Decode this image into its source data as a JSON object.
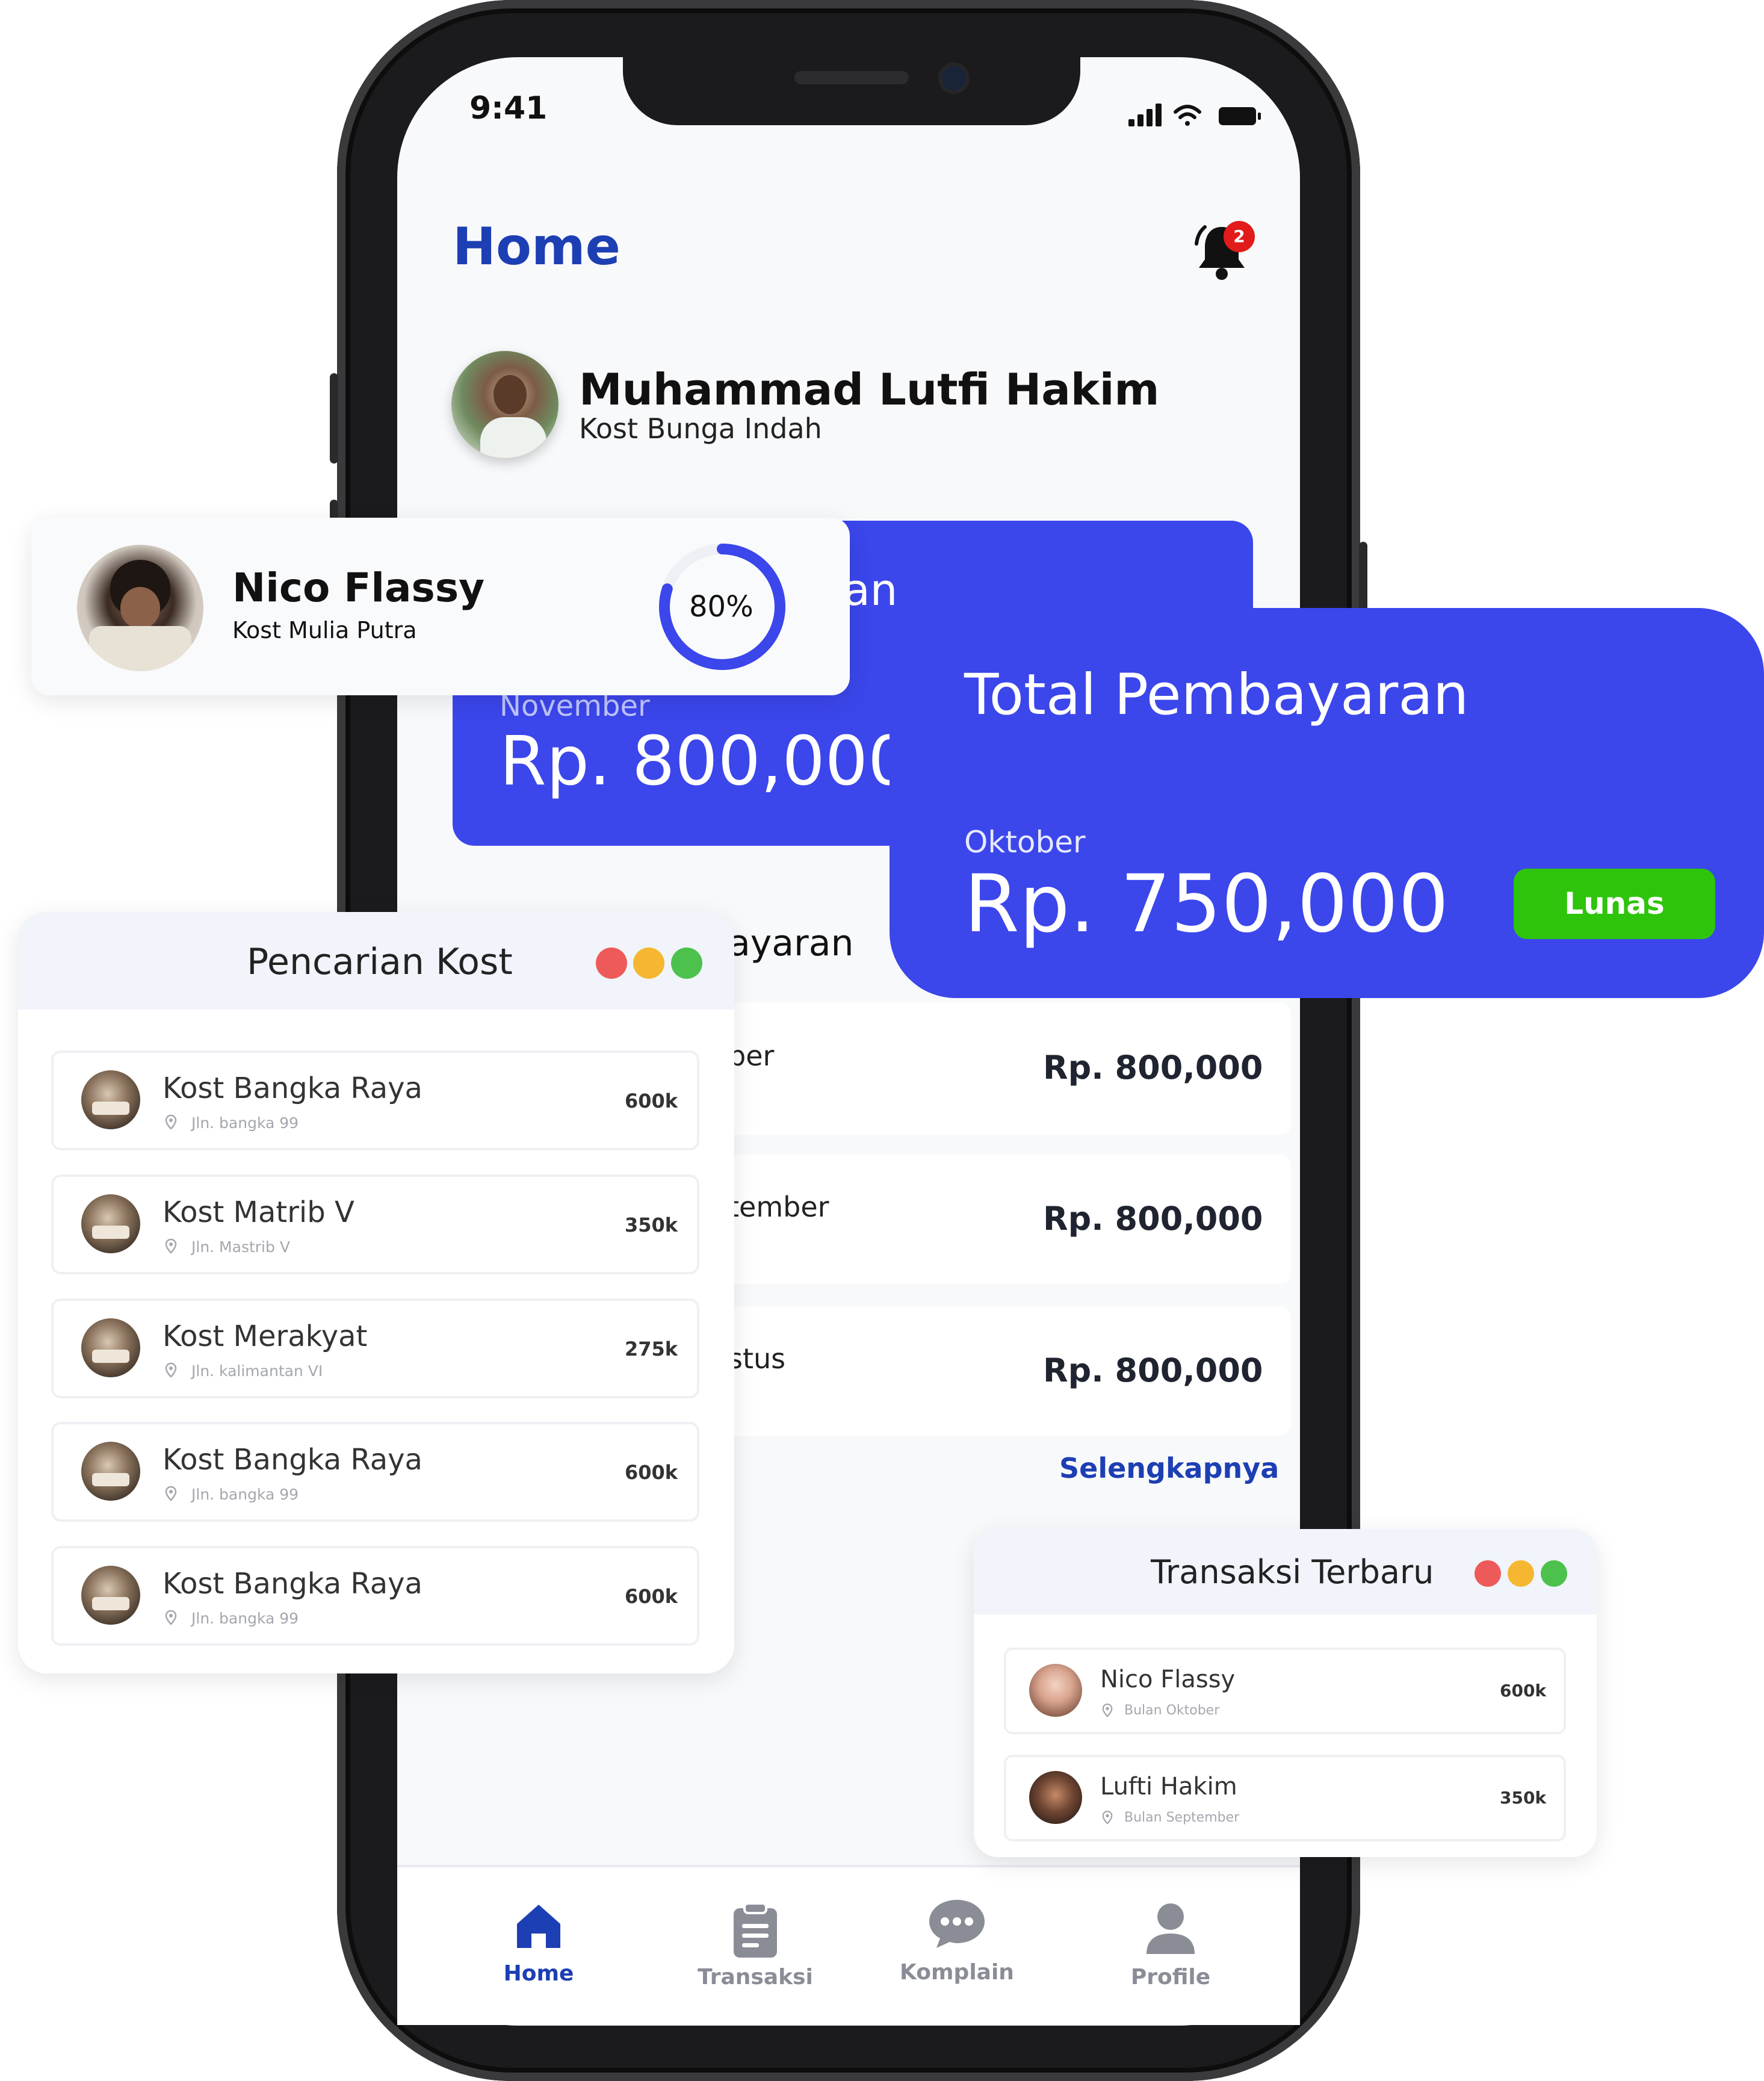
{
  "status_bar": {
    "time": "9:41"
  },
  "header": {
    "title": "Home",
    "notification_count": "2"
  },
  "user": {
    "name": "Muhammad Lutfi Hakim",
    "kost": "Kost Bunga Indah"
  },
  "phone_card": {
    "title_fragment": "ran",
    "month": "November",
    "amount": "Rp. 800,000"
  },
  "history": {
    "title_fragment": "ayaran",
    "rows": [
      {
        "month": "ber",
        "amount": "Rp. 800,000"
      },
      {
        "month": "tember",
        "amount": "Rp. 800,000"
      },
      {
        "month": "stus",
        "amount": "Rp. 800,000"
      }
    ],
    "more_label": "Selengkapnya"
  },
  "bottom_nav": {
    "items": [
      {
        "label": "Home",
        "icon": "home-icon",
        "active": true
      },
      {
        "label": "Transaksi",
        "icon": "clipboard-icon",
        "active": false
      },
      {
        "label": "Komplain",
        "icon": "chat-icon",
        "active": false
      },
      {
        "label": "Profile",
        "icon": "user-icon",
        "active": false
      }
    ]
  },
  "nico_card": {
    "name": "Nico Flassy",
    "kost": "Kost Mulia Putra",
    "progress_label": "80%",
    "progress": 0.8
  },
  "total_card": {
    "title": "Total Pembayaran",
    "month": "Oktober",
    "amount": "Rp. 750,000",
    "status": "Lunas"
  },
  "search_panel": {
    "title": "Pencarian Kost",
    "items": [
      {
        "name": "Kost Bangka Raya",
        "address": "Jln. bangka 99",
        "price": "600k"
      },
      {
        "name": "Kost Matrib V",
        "address": "Jln. Mastrib V",
        "price": "350k"
      },
      {
        "name": "Kost Merakyat",
        "address": "Jln. kalimantan VI",
        "price": "275k"
      },
      {
        "name": "Kost Bangka Raya",
        "address": "Jln. bangka 99",
        "price": "600k"
      },
      {
        "name": "Kost Bangka Raya",
        "address": "Jln. bangka 99",
        "price": "600k"
      }
    ]
  },
  "transactions_panel": {
    "title": "Transaksi Terbaru",
    "items": [
      {
        "name": "Nico Flassy",
        "sub": "Bulan Oktober",
        "price": "600k"
      },
      {
        "name": "Lufti Hakim",
        "sub": "Bulan September",
        "price": "350k"
      }
    ]
  },
  "colors": {
    "primary_blue": "#3b46eb",
    "title_blue": "#1d3fb4",
    "success_green": "#2ec40c",
    "dot_red": "#ee5a5a",
    "dot_yellow": "#f5b731",
    "dot_green": "#4cc24c"
  }
}
